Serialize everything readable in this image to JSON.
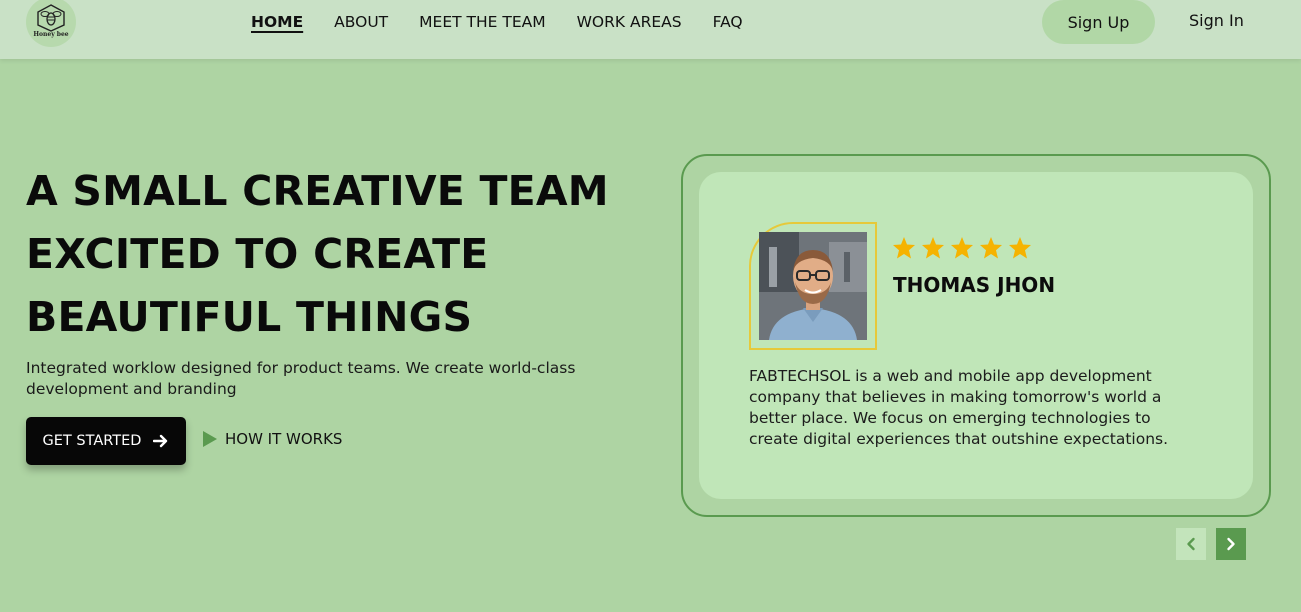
{
  "logo": {
    "text": "Honey bee",
    "icon": "bee-hexagon-icon"
  },
  "nav": [
    {
      "label": "HOME",
      "active": true
    },
    {
      "label": "ABOUT",
      "active": false
    },
    {
      "label": "MEET THE TEAM",
      "active": false
    },
    {
      "label": "WORK AREAS",
      "active": false
    },
    {
      "label": "FAQ",
      "active": false
    }
  ],
  "auth": {
    "signup_label": "Sign Up",
    "signin_label": "Sign In"
  },
  "hero": {
    "title_lines": [
      "A SMALL CREATIVE TEAM",
      "EXCITED TO CREATE",
      "BEAUTIFUL THINGS"
    ],
    "description": "Integrated worklow designed for product teams. We create world-class development and branding",
    "cta_label": "GET STARTED",
    "cta_icon": "arrow-right-icon",
    "how_label": "HOW IT WORKS",
    "how_icon": "play-icon"
  },
  "testimonial": {
    "rating": 5,
    "name": "THOMAS JHON",
    "quote": "FABTECHSOL is a web and mobile app development company that believes in making tomorrow's world a better place. We focus on emerging technologies to create digital experiences that outshine expectations."
  },
  "carousel": {
    "prev_icon": "chevron-left-icon",
    "next_icon": "chevron-right-icon"
  },
  "colors": {
    "background": "#aed4a3",
    "header": "#c9e1c6",
    "card": "#c0e6b8",
    "accent_green": "#5a9a4f",
    "star": "#f5b301",
    "frame": "#e6c93a"
  }
}
